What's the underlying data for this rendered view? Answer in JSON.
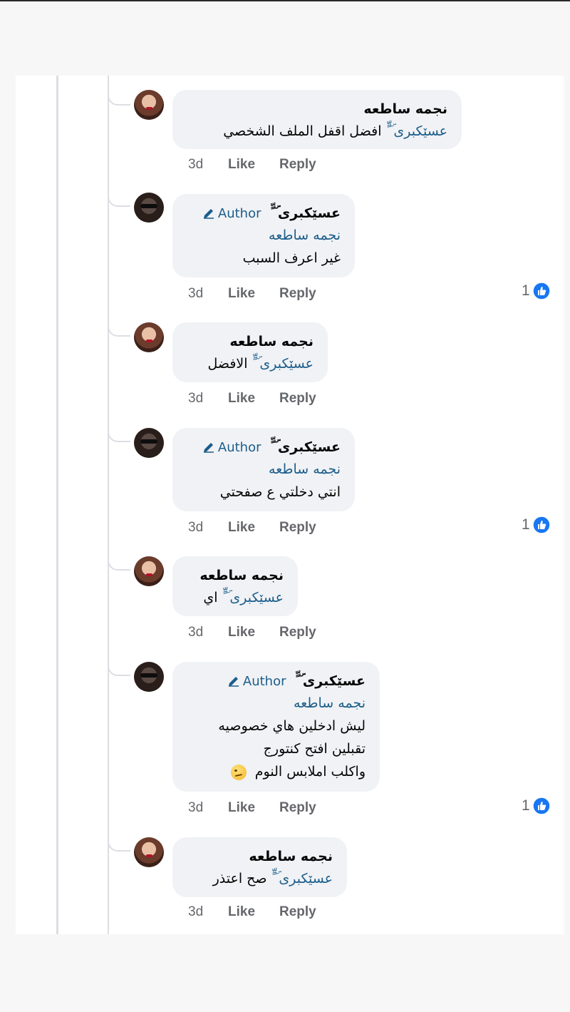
{
  "comments": [
    {
      "name": "نجمه ساطعه",
      "author": false,
      "mention": "عسێکبری ۜ ٍّ",
      "lines": [
        "افضل اقفل الملف الشخصي"
      ],
      "time": "3d",
      "like": "Like",
      "reply": "Reply",
      "reaction_count": ""
    },
    {
      "name": "عسێکبری ۜ ٍّ",
      "author": true,
      "author_label": "Author",
      "mention": "نجمه ساطعه",
      "lines": [
        "غير اعرف السبب"
      ],
      "time": "3d",
      "like": "Like",
      "reply": "Reply",
      "reaction_count": "1"
    },
    {
      "name": "نجمه ساطعه",
      "author": false,
      "mention": "عسێکبری ۜ ٍّ",
      "lines": [
        "الافضل"
      ],
      "time": "3d",
      "like": "Like",
      "reply": "Reply",
      "reaction_count": ""
    },
    {
      "name": "عسێکبری ۜ ٍّ",
      "author": true,
      "author_label": "Author",
      "mention": "نجمه ساطعه",
      "lines": [
        "انتي دخلتي ع صفحتي"
      ],
      "time": "3d",
      "like": "Like",
      "reply": "Reply",
      "reaction_count": "1"
    },
    {
      "name": "نجمه ساطعه",
      "author": false,
      "mention": "عسێکبری ۜ ٍّ",
      "lines": [
        "اي"
      ],
      "time": "3d",
      "like": "Like",
      "reply": "Reply",
      "reaction_count": ""
    },
    {
      "name": "عسێکبری ۜ ٍّ",
      "author": true,
      "author_label": "Author",
      "mention": "نجمه ساطعه",
      "lines": [
        "ليش ادخلين هاي خصوصيه",
        "تقبلين افتح كنتورج",
        "واكلب املابس النوم"
      ],
      "emoji": "smirk-emoji",
      "time": "3d",
      "like": "Like",
      "reply": "Reply",
      "reaction_count": "1"
    },
    {
      "name": "نجمه ساطعه",
      "author": false,
      "mention": "عسێکبری ۜ ٍّ",
      "lines": [
        "صح اعتذر"
      ],
      "time": "3d",
      "like": "Like",
      "reply": "Reply",
      "reaction_count": ""
    }
  ],
  "colors": {
    "mention": "#1c5d8a",
    "bubble": "#f0f2f5",
    "like_blue": "#1877f2",
    "meta": "#65676b"
  }
}
